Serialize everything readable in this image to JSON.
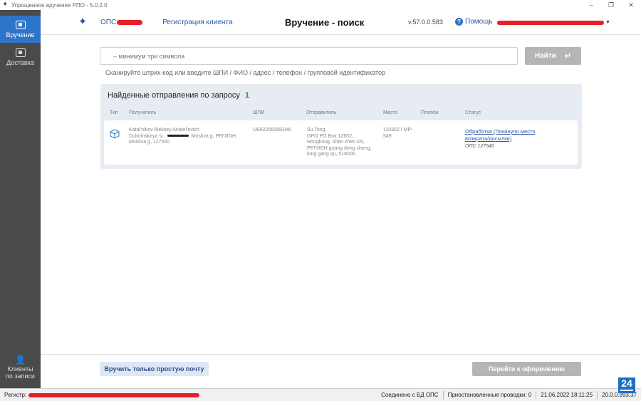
{
  "window": {
    "title": "Упрощенное вручение РПО - 5.0.2.0",
    "minimize_glyph": "–",
    "restore_glyph": "❐",
    "close_glyph": "✕"
  },
  "sidebar": {
    "items": [
      {
        "label": "Вручение",
        "icon": "handover-icon",
        "active": true
      },
      {
        "label": "Доставка",
        "icon": "delivery-icon",
        "active": false
      }
    ],
    "bottom_item": {
      "label_line1": "Клиенты",
      "label_line2": "по записи",
      "icon": "person-icon"
    }
  },
  "header": {
    "ops_label": "ОПС",
    "register_client": "Регистрация клиента",
    "page_title": "Вручение - поиск",
    "version": "v.57.0.0.583",
    "help": "Помощь"
  },
  "search": {
    "placeholder": "– минимум три символа",
    "button_label": "Найти",
    "hint": "Сканируйте штрих-код или введите ШПИ / ФИО / адрес / телефон / групповой идентификатор"
  },
  "results": {
    "title": "Найденные отправления по запросу",
    "count": "1",
    "columns": {
      "type": "Тип",
      "recipient": "Получатель",
      "shpi": "ШПИ",
      "sender": "Отправитель",
      "place": "Место",
      "payment": "Платёж",
      "status": "Статус"
    },
    "rows": [
      {
        "recipient_name": "Katal'nikov Aleksey Anatol'evich",
        "recipient_addr1_a": "Dubninskaya st.,",
        "recipient_addr1_b": ", Moskva g, РЕГИОН",
        "recipient_addr2": "Moskva g, 127540",
        "shpi": "UB822560882HK",
        "sender_lines": [
          "Su Tong",
          "GPO PO Box 12602,",
          "Hongkong, shen zhen shi,",
          "РЕГИОН guang dong sheng,",
          "long gang qu, 518000"
        ],
        "place_line1": "110302 / МР-",
        "place_line2": "549",
        "status_line1": "Обработка (Покинуло место",
        "status_line2": "возврата/досылки)",
        "status_office": "ОПС 127540"
      }
    ]
  },
  "footer": {
    "simple_mail_button": "Вручить только простую почту",
    "proceed_button": "Перейти к оформлению"
  },
  "statusbar": {
    "register_label": "Регистр:",
    "db_status": "Соединено с БД ОПС",
    "suspended": "Приостановленные проводки: 0",
    "datetime": "21.06.2022 18:11:25",
    "build": "20.0.0.993.37"
  },
  "badge": "24",
  "colors": {
    "accent": "#2e74c9",
    "sidebar_bg": "#4a4a4a",
    "link": "#2b57a7",
    "redaction": "#e3202a",
    "count_green": "#2e9a3a"
  }
}
